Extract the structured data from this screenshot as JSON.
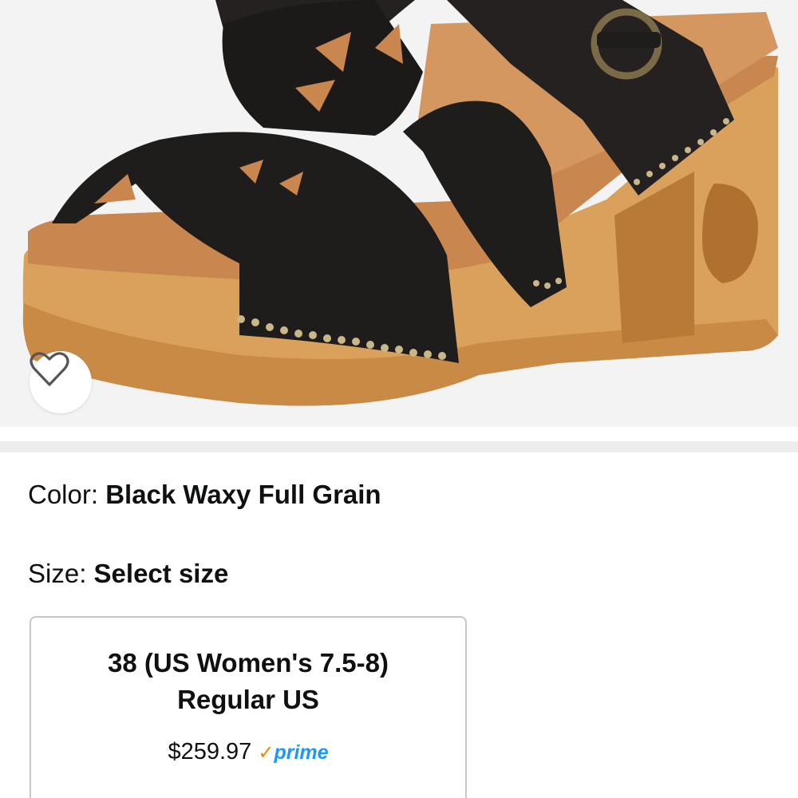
{
  "product": {
    "image_alt": "Black leather cut-out clog sandal with wooden heel",
    "wishlist_icon": "heart-outline-icon",
    "color": {
      "label": "Color: ",
      "value": "Black Waxy Full Grain"
    },
    "size": {
      "label": "Size: ",
      "value": "Select size"
    },
    "size_option": {
      "line1": "38 (US Women's 7.5-8)",
      "line2": "Regular US",
      "price": "$259.97",
      "prime_label": "prime",
      "prime_check": "✓"
    }
  },
  "colors": {
    "background": "#f3f3f3",
    "text": "#0f1111",
    "prime_blue": "#1a98ff",
    "prime_check": "#f08804",
    "card_border": "#c7c7c7"
  }
}
